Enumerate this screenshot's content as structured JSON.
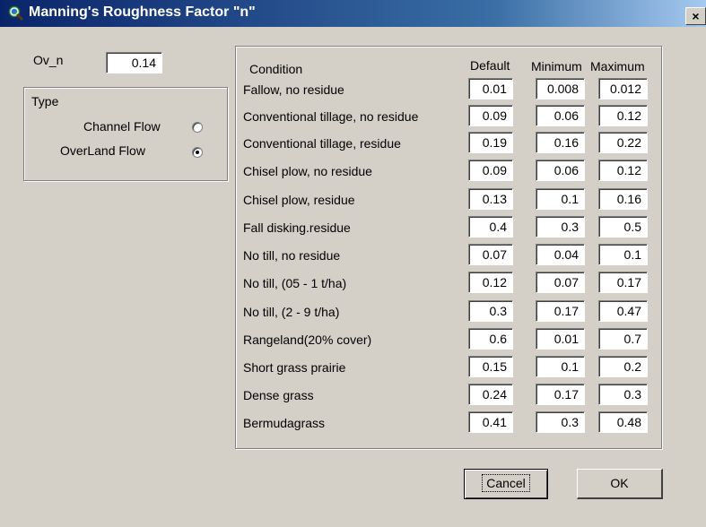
{
  "window": {
    "title": "Manning's Roughness Factor \"n\"",
    "close_label": "×"
  },
  "ov_n": {
    "label": "Ov_n",
    "value": "0.14"
  },
  "type_group": {
    "title": "Type",
    "options": [
      {
        "label": "Channel Flow",
        "selected": false
      },
      {
        "label": "OverLand Flow",
        "selected": true
      }
    ]
  },
  "table": {
    "headers": {
      "condition": "Condition",
      "default": "Default",
      "minimum": "Minimum",
      "maximum": "Maximum"
    },
    "rows": [
      {
        "condition": "Fallow, no residue",
        "default": "0.01",
        "minimum": "0.008",
        "maximum": "0.012"
      },
      {
        "condition": "Conventional tillage, no residue",
        "default": "0.09",
        "minimum": "0.06",
        "maximum": "0.12"
      },
      {
        "condition": "Conventional tillage, residue",
        "default": "0.19",
        "minimum": "0.16",
        "maximum": "0.22"
      },
      {
        "condition": "Chisel plow, no residue",
        "default": "0.09",
        "minimum": "0.06",
        "maximum": "0.12"
      },
      {
        "condition": "Chisel plow, residue",
        "default": "0.13",
        "minimum": "0.1",
        "maximum": "0.16"
      },
      {
        "condition": "Fall disking.residue",
        "default": "0.4",
        "minimum": "0.3",
        "maximum": "0.5"
      },
      {
        "condition": "No till, no residue",
        "default": "0.07",
        "minimum": "0.04",
        "maximum": "0.1"
      },
      {
        "condition": "No till, (05 - 1 t/ha)",
        "default": "0.12",
        "minimum": "0.07",
        "maximum": "0.17"
      },
      {
        "condition": "No till, (2 - 9 t/ha)",
        "default": "0.3",
        "minimum": "0.17",
        "maximum": "0.47"
      },
      {
        "condition": "Rangeland(20% cover)",
        "default": "0.6",
        "minimum": "0.01",
        "maximum": "0.7"
      },
      {
        "condition": "Short grass prairie",
        "default": "0.15",
        "minimum": "0.1",
        "maximum": "0.2"
      },
      {
        "condition": "Dense grass",
        "default": "0.24",
        "minimum": "0.17",
        "maximum": "0.3"
      },
      {
        "condition": "Bermudagrass",
        "default": "0.41",
        "minimum": "0.3",
        "maximum": "0.48"
      }
    ]
  },
  "buttons": {
    "cancel": "Cancel",
    "ok": "OK"
  }
}
